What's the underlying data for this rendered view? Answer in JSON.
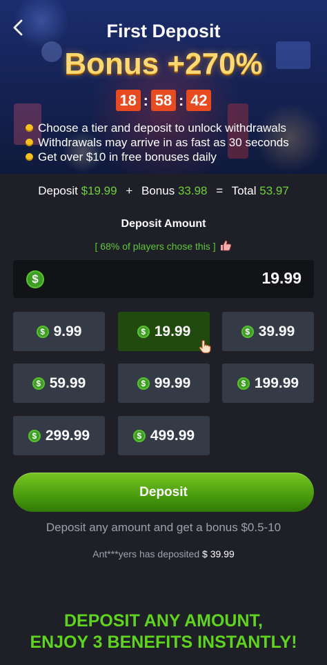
{
  "header": {
    "title": "First Deposit",
    "bonus_headline": "Bonus +270%",
    "countdown": {
      "hours": "18",
      "minutes": "58",
      "seconds": "42",
      "separator": ":"
    },
    "benefits": [
      "Choose a tier and deposit to unlock withdrawals",
      "Withdrawals may arrive in as fast as 30 seconds",
      "Get over $10 in free bonuses daily"
    ]
  },
  "summary": {
    "deposit_label": "Deposit",
    "deposit_value": "$19.99",
    "plus": "+",
    "bonus_label": "Bonus",
    "bonus_value": "33.98",
    "equals": "=",
    "total_label": "Total",
    "total_value": "53.97"
  },
  "deposit_section": {
    "title": "Deposit Amount",
    "popularity": "[ 68% of players chose this ]",
    "currency_symbol": "$",
    "amount_value": "19.99"
  },
  "tiers": [
    {
      "value": "9.99",
      "selected": false
    },
    {
      "value": "19.99",
      "selected": true
    },
    {
      "value": "39.99",
      "selected": false
    },
    {
      "value": "59.99",
      "selected": false
    },
    {
      "value": "99.99",
      "selected": false
    },
    {
      "value": "199.99",
      "selected": false
    },
    {
      "value": "299.99",
      "selected": false
    },
    {
      "value": "499.99",
      "selected": false
    }
  ],
  "deposit_button": {
    "label": "Deposit"
  },
  "hint": "Deposit any amount and get a bonus $0.5-10",
  "recent_deposit": {
    "user": "Ant***yers has deposited",
    "amount": "$ 39.99"
  },
  "promo": {
    "line1": "DEPOSIT ANY AMOUNT,",
    "line2": "ENJOY 3 BENEFITS INSTANTLY!"
  },
  "colors": {
    "accent_green": "#6fd03c",
    "timer_orange": "#e74b1f",
    "bonus_gold": "#ffd870",
    "background": "#1f2027",
    "tile": "#353a47",
    "tile_selected": "#204a0e"
  },
  "icons": [
    "back-chevron-icon",
    "bullet-coin-icon",
    "dollar-coin-icon",
    "hand-pointer-icon"
  ]
}
